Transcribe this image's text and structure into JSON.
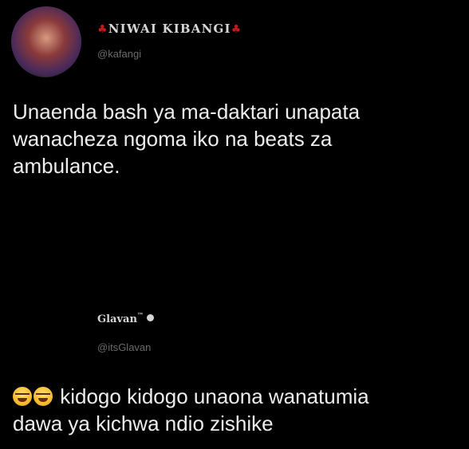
{
  "tweets": [
    {
      "display_name": "NIWAI KIBANGI",
      "name_decor_icon": "maple-leaf-icon",
      "handle": "@kafangi",
      "text": "Unaenda bash ya ma-daktari unapata\nwanacheza ngoma iko na beats za\nambulance."
    },
    {
      "display_name": "Glavan",
      "name_suffix": "™",
      "badge_icon": "verified-dot-icon",
      "handle": "@itsGlavan",
      "emoji": [
        "face-with-tears-of-joy-icon",
        "face-with-tears-of-joy-icon"
      ],
      "text": "kidogo kidogo unaona wanatumia\ndawa ya kichwa ndio zishike"
    }
  ],
  "colors": {
    "background": "#000000",
    "text": "#ececec",
    "handle": "#6a6a6a",
    "leaf": "#c21a1a"
  }
}
